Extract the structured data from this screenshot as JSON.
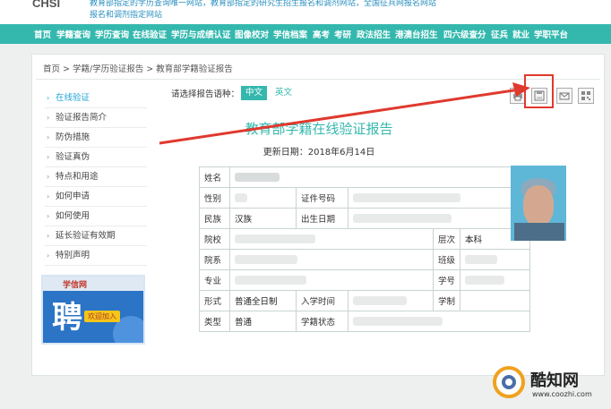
{
  "topbar": {
    "brand": "CHSI",
    "notice_line1": "教育部指定的学历查询唯一网站，教育部指定的研究生招生报名和调剂网站，全国征兵网报名网站",
    "notice_line2": "报名和调剂指定网站"
  },
  "nav": [
    "首页",
    "学籍查询",
    "学历查询",
    "在线验证",
    "学历与成绩认证",
    "图像校对",
    "学信档案",
    "高考",
    "考研",
    "政法招生",
    "港澳台招生",
    "四六级查分",
    "征兵",
    "就业",
    "学职平台"
  ],
  "breadcrumb": [
    "首页",
    "学籍/学历验证报告",
    "教育部学籍验证报告"
  ],
  "breadcrumb_sep": ">",
  "sidebar": [
    {
      "label": "在线验证",
      "active": true
    },
    {
      "label": "验证报告简介",
      "active": false
    },
    {
      "label": "防伪措施",
      "active": false
    },
    {
      "label": "验证真伪",
      "active": false
    },
    {
      "label": "特点和用途",
      "active": false
    },
    {
      "label": "如何申请",
      "active": false
    },
    {
      "label": "如何使用",
      "active": false
    },
    {
      "label": "延长验证有效期",
      "active": false
    },
    {
      "label": "特别声明",
      "active": false
    }
  ],
  "ad": {
    "site": "学信网",
    "big": "聘",
    "tag": "欢迎加入"
  },
  "lang": {
    "prompt": "请选择报告语种：",
    "chinese": "中文",
    "english": "英文"
  },
  "tools": [
    "print-icon",
    "save-icon",
    "mail-icon",
    "qrcode-icon"
  ],
  "report": {
    "title": "教育部学籍在线验证报告",
    "date_label": "更新日期：",
    "date": "2018年6月14日"
  },
  "fields": {
    "name": "姓名",
    "gender": "性别",
    "id_no": "证件号码",
    "ethnic": "民族",
    "ethnic_value": "汉族",
    "birth": "出生日期",
    "school": "院校",
    "level": "层次",
    "level_value": "本科",
    "dept": "院系",
    "class": "班级",
    "major": "专业",
    "student_no": "学号",
    "form": "形式",
    "form_value": "普通全日制",
    "enroll_date": "入学时间",
    "study_len": "学制",
    "type": "类型",
    "type_value": "普通",
    "status": "学籍状态"
  },
  "watermark": {
    "name": "酷知网",
    "url": "www.coozhi.com"
  },
  "colors": {
    "accent": "#34b8ae",
    "link": "#22a3d6",
    "highlight": "#e0392e"
  }
}
